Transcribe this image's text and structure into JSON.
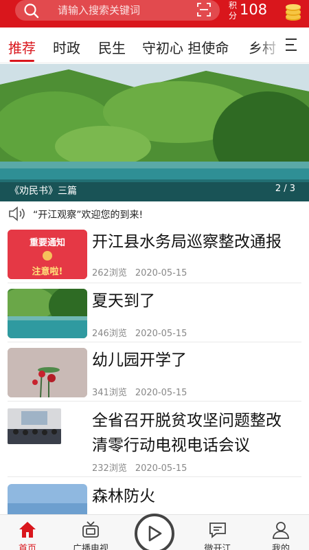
{
  "colors": {
    "accent": "#d9161c"
  },
  "header": {
    "search_placeholder": "请输入搜索关键词",
    "points_label": "积分",
    "points_value": "108",
    "icons": [
      "search-icon",
      "scan-icon",
      "coins-icon"
    ]
  },
  "tabs": [
    {
      "label": "推荐",
      "active": true
    },
    {
      "label": "时政"
    },
    {
      "label": "民生"
    },
    {
      "label": "守初心 担使命"
    },
    {
      "label": "乡村"
    }
  ],
  "banner": {
    "caption": "《劝民书》三篇",
    "index": "2 / 3"
  },
  "notice": {
    "text": "“开江观察”欢迎您的到来!"
  },
  "news": [
    {
      "title": "开江县水务局巡察整改通报",
      "views": "262浏览",
      "date": "2020-05-15",
      "thumb": {
        "line1": "重要通知",
        "line2": "注意啦!"
      }
    },
    {
      "title": "夏天到了",
      "views": "246浏览",
      "date": "2020-05-15"
    },
    {
      "title": "幼儿园开学了",
      "views": "341浏览",
      "date": "2020-05-15"
    },
    {
      "title_line1": "全省召开脱贫攻坚问题整改",
      "title_line2": "清零行动电视电话会议",
      "views": "232浏览",
      "date": "2020-05-15"
    },
    {
      "title": "森林防火"
    }
  ],
  "bottom_nav": [
    {
      "label": "首页",
      "icon": "home-icon",
      "active": true
    },
    {
      "label": "广播电视",
      "icon": "tv-icon"
    },
    {
      "label": "",
      "icon": "play-icon"
    },
    {
      "label": "微开江",
      "icon": "chat-icon"
    },
    {
      "label": "我的",
      "icon": "user-icon"
    }
  ]
}
